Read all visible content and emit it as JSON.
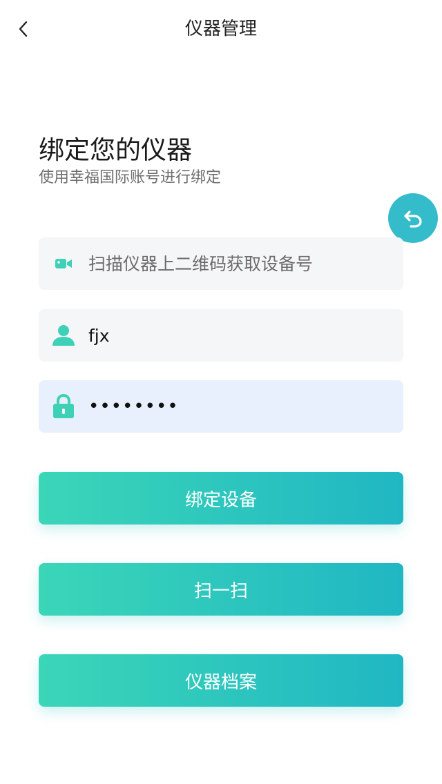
{
  "header": {
    "title": "仪器管理"
  },
  "intro": {
    "title": "绑定您的仪器",
    "subtitle": "使用幸福国际账号进行绑定"
  },
  "form": {
    "device_placeholder": "扫描仪器上二维码获取设备号",
    "username_value": "fjx",
    "password_value": "12345678"
  },
  "buttons": {
    "bind": "绑定设备",
    "scan": "扫一扫",
    "archive": "仪器档案"
  },
  "icons": {
    "back": "chevron-left-icon",
    "undo": "undo-icon",
    "device": "video-camera-icon",
    "user": "user-icon",
    "lock": "lock-icon"
  },
  "colors": {
    "accent": "#3ed1b7",
    "gradient_start": "#3bd6b8",
    "gradient_end": "#20b7c3",
    "float_button": "#35bccb",
    "field_bg": "#f5f6f8",
    "field_active_bg": "#e8f0fd"
  }
}
